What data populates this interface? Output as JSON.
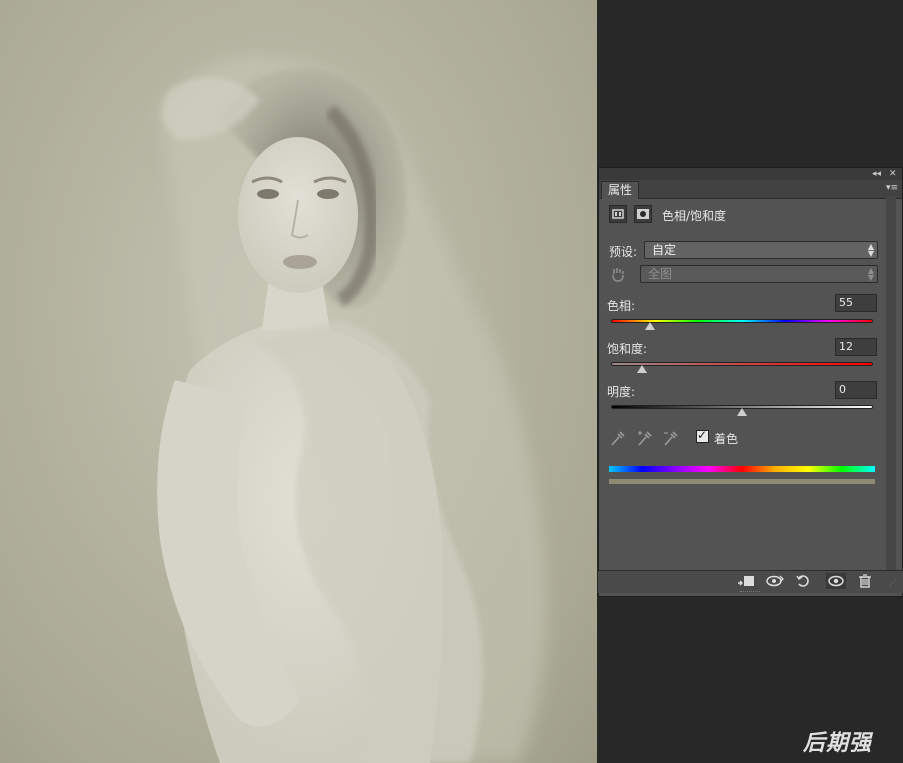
{
  "panel": {
    "tab_label": "属性",
    "title": "色相/饱和度",
    "preset_label": "预设:",
    "preset_value": "自定",
    "channel_value": "全图",
    "hue": {
      "label": "色相:",
      "value": "55",
      "level": 0.15
    },
    "saturation": {
      "label": "饱和度:",
      "value": "12",
      "level": 0.12
    },
    "lightness": {
      "label": "明度:",
      "value": "0",
      "level": 0.5
    },
    "colorize_label": "着色",
    "colorize_checked": true,
    "colorize_swatch_color": "#8f8a73"
  },
  "icons": {
    "collapse": "double-chevron-icon",
    "close": "close-icon",
    "panel_menu": "menu-icon",
    "header_adjustment": "adjustment-icon",
    "header_mask": "mask-icon",
    "targeted_adjust": "hand-icon",
    "eyedroppers": [
      "eyedropper-icon",
      "eyedropper-plus-icon",
      "eyedropper-minus-icon"
    ],
    "bottom": [
      "clip-to-layer-icon",
      "view-previous-icon",
      "reset-icon",
      "visibility-icon",
      "trash-icon"
    ]
  },
  "watermark": "后期强"
}
